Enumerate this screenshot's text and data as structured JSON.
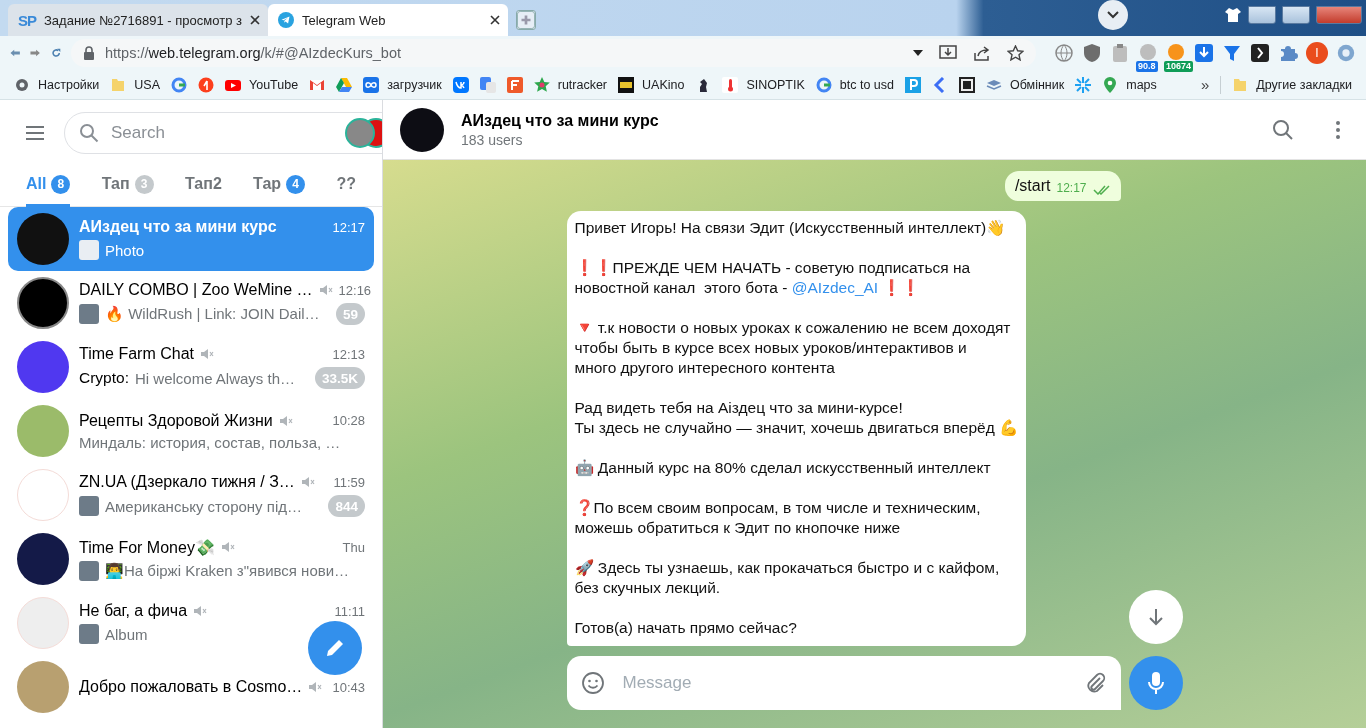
{
  "browser": {
    "tabs": [
      {
        "title": "Задание №2716891 - просмотр з",
        "favicon_text": "SP",
        "selected": false
      },
      {
        "title": "Telegram Web",
        "selected": true
      }
    ],
    "url": {
      "scheme": "https://",
      "host": "web.telegram.org",
      "path": "/k/#@AIzdecKurs_bot"
    },
    "extension_badges": [
      {
        "text": "90.8",
        "color": "#1a73e8"
      },
      {
        "text": "10674",
        "color": "#0f9d58"
      }
    ],
    "profile_initial": "I",
    "bookmarks": [
      {
        "kind": "labeled",
        "label": "Настройки"
      },
      {
        "kind": "labeled",
        "label": "USA"
      },
      {
        "kind": "icon"
      },
      {
        "kind": "icon"
      },
      {
        "kind": "labeled",
        "label": "YouTube"
      },
      {
        "kind": "icon"
      },
      {
        "kind": "icon"
      },
      {
        "kind": "labeled",
        "label": "загрузчик"
      },
      {
        "kind": "icon"
      },
      {
        "kind": "icon"
      },
      {
        "kind": "icon"
      },
      {
        "kind": "labeled",
        "label": "rutracker"
      },
      {
        "kind": "labeled",
        "label": "UAKino"
      },
      {
        "kind": "icon"
      },
      {
        "kind": "labeled",
        "label": "SINOPTIK"
      },
      {
        "kind": "labeled",
        "label": "btc to usd"
      },
      {
        "kind": "icon"
      },
      {
        "kind": "icon"
      },
      {
        "kind": "icon"
      },
      {
        "kind": "labeled",
        "label": "Обмінник"
      },
      {
        "kind": "icon"
      },
      {
        "kind": "labeled",
        "label": "maps"
      }
    ],
    "bookmarks_more": "»",
    "other_bookmarks": "Другие закладки"
  },
  "sidebar": {
    "search": {
      "placeholder": "Search"
    },
    "folders": [
      {
        "label": "All",
        "badge": "8",
        "badge_muted": false,
        "selected": true
      },
      {
        "label": "Тап",
        "badge": "3",
        "badge_muted": true,
        "selected": false
      },
      {
        "label": "Тап2",
        "selected": false
      },
      {
        "label": "Тар",
        "badge": "4",
        "badge_muted": false,
        "selected": false
      },
      {
        "label": "??",
        "selected": false
      }
    ],
    "chats": [
      {
        "name": "АИздец что за мини курс",
        "muted": false,
        "time": "12:17",
        "thumbnail": true,
        "preview": "Photo",
        "selected": true
      },
      {
        "name": "DAILY COMBO | Zoo WeMine …",
        "muted": true,
        "time": "12:16",
        "thumbnail": true,
        "preview": "🔥 WildRush | Link: JOIN Dail…",
        "unread": "59",
        "selected": false
      },
      {
        "name": "Time Farm Chat",
        "muted": true,
        "time": "12:13",
        "thumbnail": false,
        "sender": "Crypto:",
        "preview": "Hi welcome Always th…",
        "unread": "33.5K",
        "selected": false
      },
      {
        "name": "Рецепты Здоровой Жизни",
        "muted": true,
        "time": "10:28",
        "thumbnail": false,
        "preview": "Миндаль: история, состав, польза, …",
        "selected": false
      },
      {
        "name": "ZN.UA (Дзеркало тижня / З…",
        "muted": true,
        "time": "11:59",
        "thumbnail": true,
        "preview": "Американську сторону під…",
        "unread": "844",
        "selected": false
      },
      {
        "name": "Time For Money💸",
        "muted": true,
        "time": "Thu",
        "thumbnail": true,
        "preview": "👨‍💻На біржі Kraken з\"явився нови…",
        "selected": false
      },
      {
        "name": "Не баг, а фича",
        "muted": true,
        "time": "11:11",
        "thumbnail": true,
        "preview": "Album",
        "selected": false
      },
      {
        "name": "Добро пожаловать в Cosmo…",
        "muted": true,
        "time": "10:43",
        "selected": false
      }
    ]
  },
  "chat": {
    "title": "АИздец что за мини курс",
    "subtitle": "183 users",
    "messages": [
      {
        "kind": "outgoing",
        "text": "/start",
        "time": "12:17",
        "read": true
      },
      {
        "kind": "incoming",
        "paragraphs": [
          {
            "text": "Привет Игорь! На связи Эдит (Искусственный интеллект)👋"
          },
          {
            "text": "❗❗ПРЕЖДЕ ЧЕМ НАЧАТЬ - советую подписаться на\nновостной канал  этого бота - ",
            "link": "@AIzdec_AI",
            "after": " ❗❗"
          },
          {
            "text": "🔻 т.к новости о новых уроках к сожалению не всем доходят\nчтобы быть в курсе всех новых уроков/интерактивов и\nмного другого интересного контента"
          },
          {
            "text": "Рад видеть тебя на Аiздец что за мини-курсе!\nТы здесь не случайно — значит, хочешь двигаться вперёд 💪"
          },
          {
            "text": "🤖 Данный курс на 80% сделал искусственный интеллект"
          },
          {
            "text": "❓По всем своим вопросам, в том числе и техническим,\nможешь обратиться к Эдит по кнопочке ниже"
          },
          {
            "text": "🚀 Здесь ты узнаешь, как прокачаться быстро и с кайфом,\nбез скучных лекций."
          },
          {
            "text": "Готов(а) начать прямо сейчас?"
          }
        ]
      }
    ],
    "composer": {
      "placeholder": "Message"
    }
  }
}
